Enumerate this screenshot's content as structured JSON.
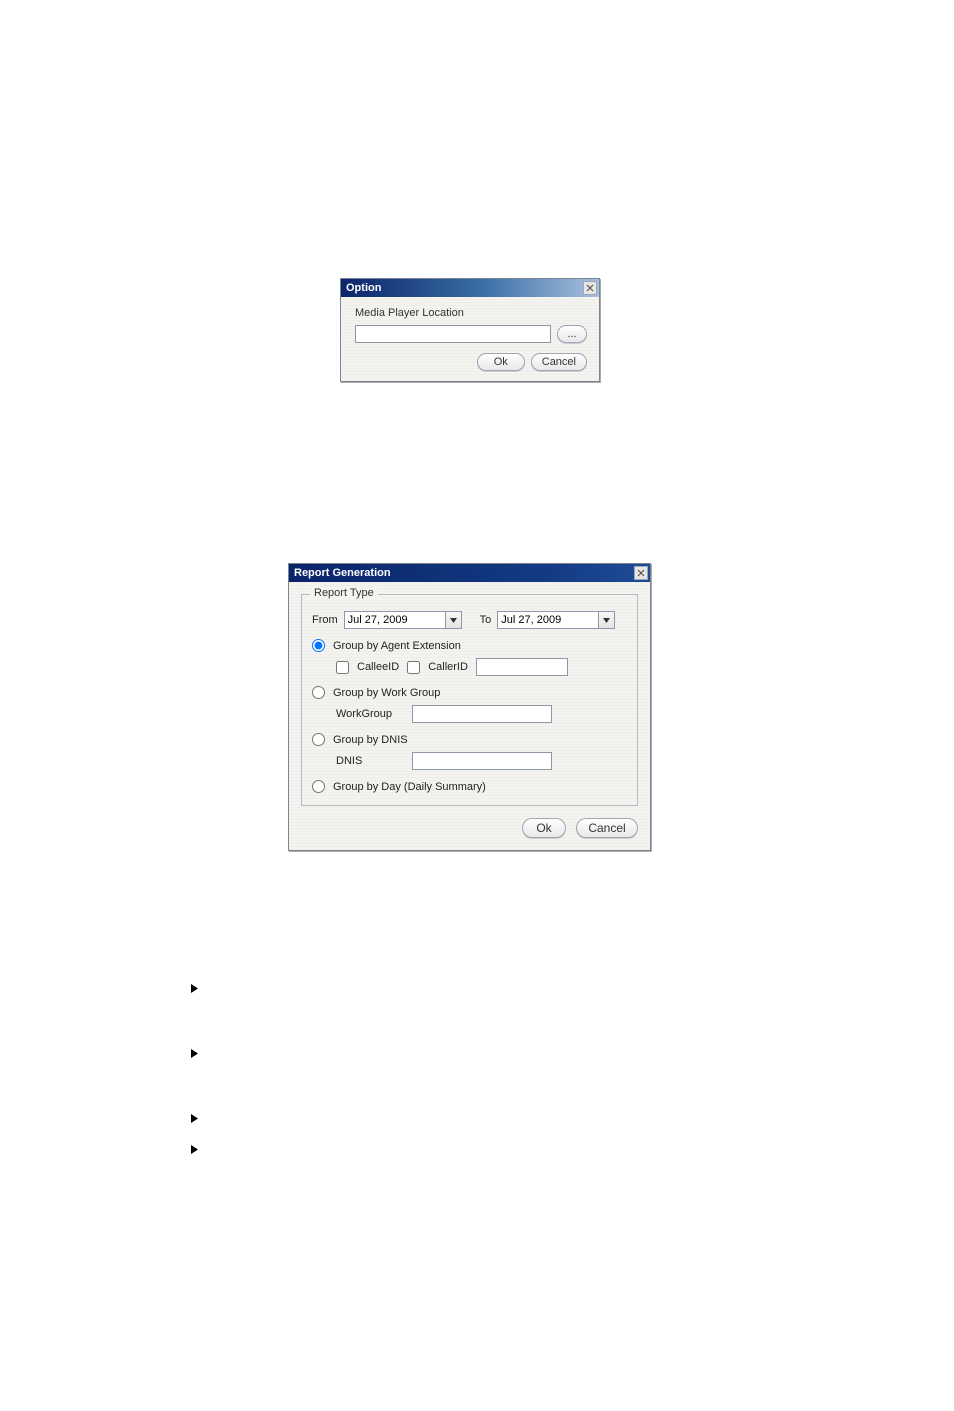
{
  "option_dialog": {
    "title": "Option",
    "label": "Media Player Location",
    "value": "",
    "browse_label": "...",
    "ok_label": "Ok",
    "cancel_label": "Cancel"
  },
  "report_dialog": {
    "title": "Report Generation",
    "groupbox_label": "Report Type",
    "from_label": "From",
    "from_value": "Jul 27, 2009",
    "to_label": "To",
    "to_value": "Jul 27, 2009",
    "radio_agent_label": "Group by Agent Extension",
    "callee_label": "CalleeID",
    "caller_label": "CallerID",
    "caller_value": "",
    "radio_workgroup_label": "Group by Work Group",
    "workgroup_field_label": "WorkGroup",
    "workgroup_value": "",
    "radio_dnis_label": "Group by DNIS",
    "dnis_field_label": "DNIS",
    "dnis_value": "",
    "radio_day_label": "Group by Day (Daily Summary)",
    "ok_label": "Ok",
    "cancel_label": "Cancel"
  }
}
